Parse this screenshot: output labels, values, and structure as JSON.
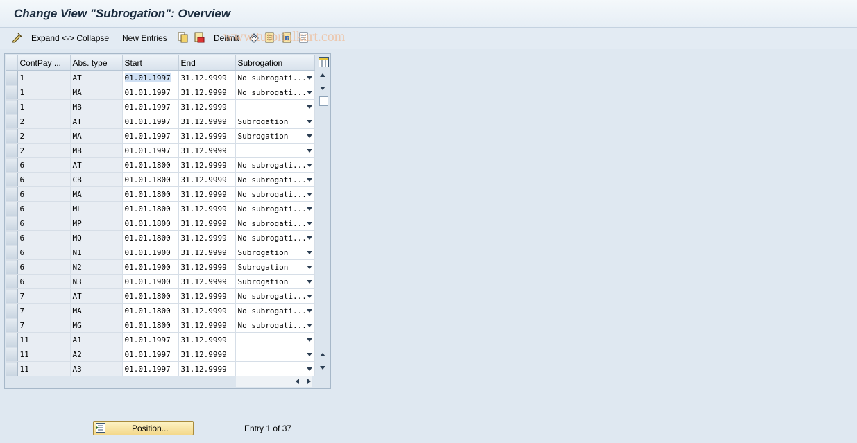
{
  "title": "Change View \"Subrogation\": Overview",
  "toolbar": {
    "expand_collapse": "Expand <-> Collapse",
    "new_entries": "New Entries",
    "delimit": "Delimit"
  },
  "watermark": "www.tutorialkart.com",
  "table": {
    "columns": [
      "ContPay ...",
      "Abs. type",
      "Start",
      "End",
      "Subrogation"
    ],
    "rows": [
      {
        "contpay": "1",
        "abs": "AT",
        "start": "01.01.1997",
        "end": "31.12.9999",
        "sub": "No subrogati..."
      },
      {
        "contpay": "1",
        "abs": "MA",
        "start": "01.01.1997",
        "end": "31.12.9999",
        "sub": "No subrogati..."
      },
      {
        "contpay": "1",
        "abs": "MB",
        "start": "01.01.1997",
        "end": "31.12.9999",
        "sub": ""
      },
      {
        "contpay": "2",
        "abs": "AT",
        "start": "01.01.1997",
        "end": "31.12.9999",
        "sub": "Subrogation"
      },
      {
        "contpay": "2",
        "abs": "MA",
        "start": "01.01.1997",
        "end": "31.12.9999",
        "sub": "Subrogation"
      },
      {
        "contpay": "2",
        "abs": "MB",
        "start": "01.01.1997",
        "end": "31.12.9999",
        "sub": ""
      },
      {
        "contpay": "6",
        "abs": "AT",
        "start": "01.01.1800",
        "end": "31.12.9999",
        "sub": "No subrogati..."
      },
      {
        "contpay": "6",
        "abs": "CB",
        "start": "01.01.1800",
        "end": "31.12.9999",
        "sub": "No subrogati..."
      },
      {
        "contpay": "6",
        "abs": "MA",
        "start": "01.01.1800",
        "end": "31.12.9999",
        "sub": "No subrogati..."
      },
      {
        "contpay": "6",
        "abs": "ML",
        "start": "01.01.1800",
        "end": "31.12.9999",
        "sub": "No subrogati..."
      },
      {
        "contpay": "6",
        "abs": "MP",
        "start": "01.01.1800",
        "end": "31.12.9999",
        "sub": "No subrogati..."
      },
      {
        "contpay": "6",
        "abs": "MQ",
        "start": "01.01.1800",
        "end": "31.12.9999",
        "sub": "No subrogati..."
      },
      {
        "contpay": "6",
        "abs": "N1",
        "start": "01.01.1900",
        "end": "31.12.9999",
        "sub": "Subrogation"
      },
      {
        "contpay": "6",
        "abs": "N2",
        "start": "01.01.1900",
        "end": "31.12.9999",
        "sub": "Subrogation"
      },
      {
        "contpay": "6",
        "abs": "N3",
        "start": "01.01.1900",
        "end": "31.12.9999",
        "sub": "Subrogation"
      },
      {
        "contpay": "7",
        "abs": "AT",
        "start": "01.01.1800",
        "end": "31.12.9999",
        "sub": "No subrogati..."
      },
      {
        "contpay": "7",
        "abs": "MA",
        "start": "01.01.1800",
        "end": "31.12.9999",
        "sub": "No subrogati..."
      },
      {
        "contpay": "7",
        "abs": "MG",
        "start": "01.01.1800",
        "end": "31.12.9999",
        "sub": "No subrogati..."
      },
      {
        "contpay": "11",
        "abs": "A1",
        "start": "01.01.1997",
        "end": "31.12.9999",
        "sub": ""
      },
      {
        "contpay": "11",
        "abs": "A2",
        "start": "01.01.1997",
        "end": "31.12.9999",
        "sub": ""
      },
      {
        "contpay": "11",
        "abs": "A3",
        "start": "01.01.1997",
        "end": "31.12.9999",
        "sub": ""
      }
    ]
  },
  "footer": {
    "position_label": "Position...",
    "entry_text": "Entry 1 of 37"
  },
  "colors": {
    "background": "#dfe8f1",
    "button_fill": "#f3d88a"
  }
}
